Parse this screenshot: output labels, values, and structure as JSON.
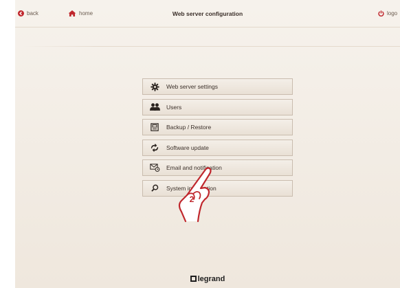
{
  "header": {
    "back_label": "back",
    "home_label": "home",
    "title": "Web server configuration",
    "logout_label": "logo"
  },
  "menu": {
    "items": [
      {
        "label": "Web server settings",
        "icon": "gear-icon"
      },
      {
        "label": "Users",
        "icon": "users-icon"
      },
      {
        "label": "Backup / Restore",
        "icon": "backup-icon"
      },
      {
        "label": "Software update",
        "icon": "update-icon"
      },
      {
        "label": "Email and notification",
        "icon": "email-icon"
      },
      {
        "label": "System information",
        "icon": "search-icon"
      }
    ]
  },
  "annotation": {
    "step": "2"
  },
  "footer": {
    "brand": "legrand"
  },
  "colors": {
    "accent_red": "#c0272d",
    "background": "#f3ede5",
    "button_border": "#c9bcae"
  }
}
